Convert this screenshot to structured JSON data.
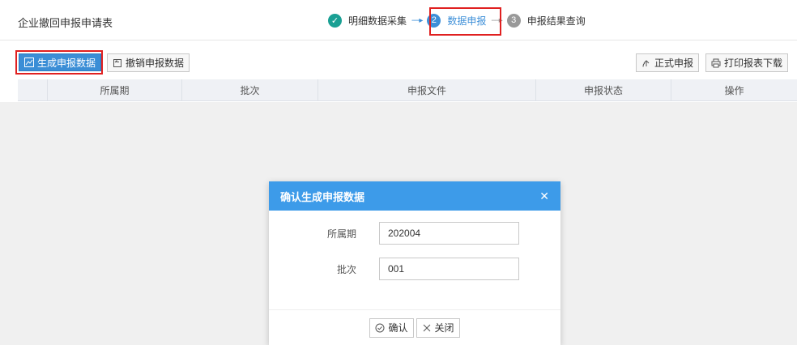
{
  "header": {
    "title": "企业撤回申报申请表",
    "steps": [
      {
        "num": "✓",
        "label": "明细数据采集"
      },
      {
        "num": "2",
        "label": "数据申报"
      },
      {
        "num": "3",
        "label": "申报结果查询"
      }
    ],
    "arrow": "----▸"
  },
  "toolbar": {
    "generate_label": "生成申报数据",
    "revoke_label": "撤销申报数据",
    "formal_label": "正式申报",
    "print_label": "打印报表下载"
  },
  "table": {
    "columns": [
      "所属期",
      "批次",
      "申报文件",
      "申报状态",
      "操作"
    ]
  },
  "dialog": {
    "title": "确认生成申报数据",
    "period_label": "所属期",
    "period_value": "202004",
    "batch_label": "批次",
    "batch_value": "001",
    "confirm_label": "确认",
    "close_label": "关闭"
  },
  "colors": {
    "accent": "#3d9be9",
    "done": "#1aa094",
    "highlight": "#e02020"
  }
}
